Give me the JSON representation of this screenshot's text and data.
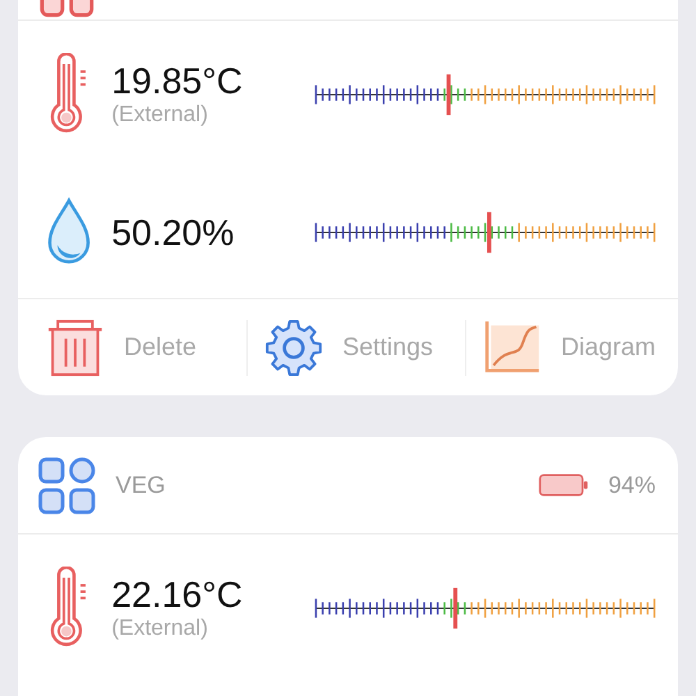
{
  "devices": [
    {
      "readings": [
        {
          "kind": "temperature",
          "value": "19.85°C",
          "source": "(External)",
          "level": 0.39
        },
        {
          "kind": "humidity",
          "value": "50.20%",
          "level": 0.51
        }
      ],
      "actions": [
        {
          "kind": "delete",
          "label": "Delete"
        },
        {
          "kind": "settings",
          "label": "Settings"
        },
        {
          "kind": "diagram",
          "label": "Diagram"
        }
      ]
    },
    {
      "name": "VEG",
      "battery": "94%",
      "readings": [
        {
          "kind": "temperature",
          "value": "22.16°C",
          "source": "(External)",
          "level": 0.41
        }
      ]
    }
  ]
}
